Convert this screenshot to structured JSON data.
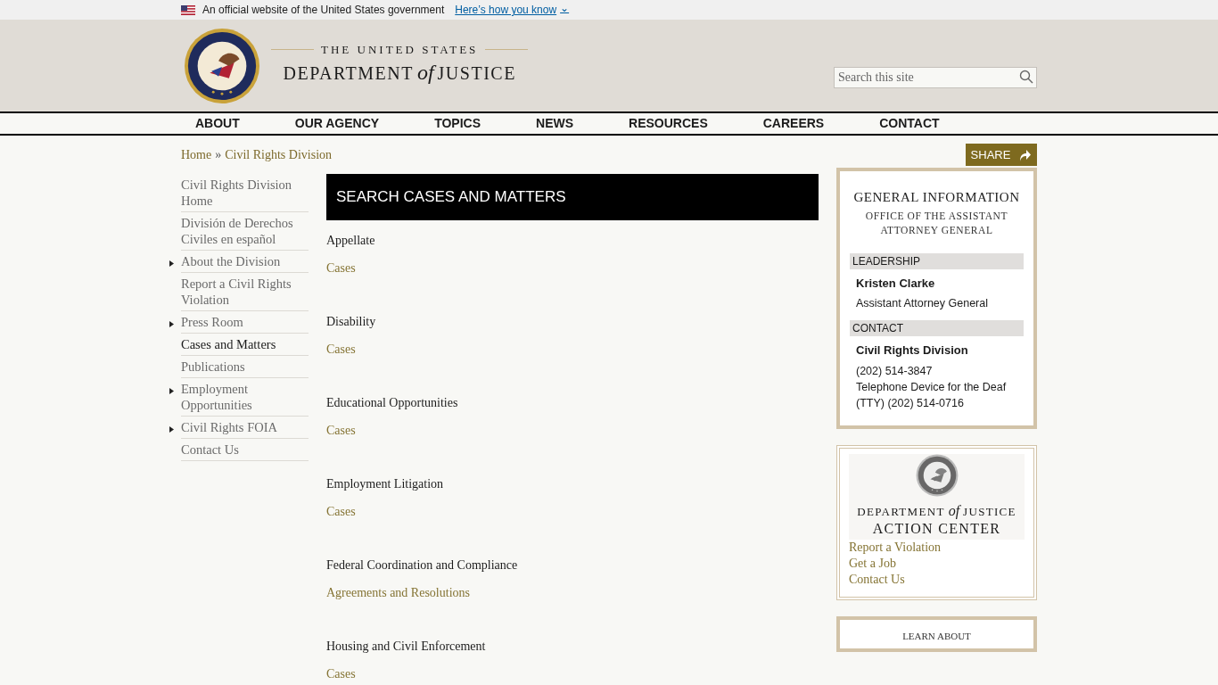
{
  "gov_banner": {
    "text": "An official website of the United States government",
    "link": "Here’s how you know",
    "caret": "⌄"
  },
  "header": {
    "logo_line1": "THE UNITED STATES",
    "logo_line2a": "DEPARTMENT",
    "logo_of": "of",
    "logo_line2b": "JUSTICE",
    "search": {
      "placeholder": "Search this site"
    }
  },
  "main_nav": [
    {
      "label": "ABOUT"
    },
    {
      "label": "OUR AGENCY"
    },
    {
      "label": "TOPICS"
    },
    {
      "label": "NEWS"
    },
    {
      "label": "RESOURCES"
    },
    {
      "label": "CAREERS"
    },
    {
      "label": "CONTACT"
    }
  ],
  "breadcrumb": [
    {
      "label": "Home"
    },
    {
      "label": "Civil Rights Division"
    }
  ],
  "breadcrumb_separator": "»",
  "share_button": "SHARE",
  "sidebar": {
    "items": [
      {
        "label": "Civil Rights Division Home",
        "expandable": false,
        "selected": false
      },
      {
        "label": "División de Derechos Civiles en español",
        "expandable": false,
        "selected": false
      },
      {
        "label": "About the Division",
        "expandable": true,
        "selected": false
      },
      {
        "label": "Report a Civil Rights Violation",
        "expandable": false,
        "selected": false
      },
      {
        "label": "Press Room",
        "expandable": true,
        "selected": false
      },
      {
        "label": "Cases and Matters",
        "expandable": false,
        "selected": true
      },
      {
        "label": "Publications",
        "expandable": false,
        "selected": false
      },
      {
        "label": "Employment Opportunities",
        "expandable": true,
        "selected": false
      },
      {
        "label": "Civil Rights FOIA",
        "expandable": true,
        "selected": false
      },
      {
        "label": "Contact Us",
        "expandable": false,
        "selected": false
      }
    ]
  },
  "page_title": "SEARCH CASES AND MATTERS",
  "sections": [
    {
      "heading": "Appellate",
      "link": "Cases"
    },
    {
      "heading": "Disability",
      "link": "Cases"
    },
    {
      "heading": "Educational Opportunities",
      "link": "Cases"
    },
    {
      "heading": "Employment Litigation",
      "link": "Cases"
    },
    {
      "heading": "Federal Coordination and Compliance",
      "link": "Agreements and Resolutions"
    },
    {
      "heading": "Housing and Civil Enforcement",
      "link": "Cases"
    }
  ],
  "general_information": {
    "title": "GENERAL INFORMATION",
    "subtitle": "OFFICE OF THE ASSISTANT ATTORNEY GENERAL",
    "blocks": [
      {
        "heading": "LEADERSHIP",
        "name": "Kristen Clarke",
        "lines": [
          "Assistant Attorney General"
        ]
      },
      {
        "heading": "CONTACT",
        "name": "Civil Rights Division",
        "lines": [
          "(202) 514-3847",
          "Telephone Device for the Deaf (TTY) (202) 514-0716"
        ]
      }
    ]
  },
  "action_center": {
    "banner_line1a": "DEPARTMENT",
    "banner_of": "of",
    "banner_line1b": "JUSTICE",
    "banner_line2": "ACTION CENTER",
    "links": [
      "Report a Violation",
      "Get a Job",
      "Contact Us"
    ]
  },
  "learn_about": {
    "title": "LEARN ABOUT"
  }
}
